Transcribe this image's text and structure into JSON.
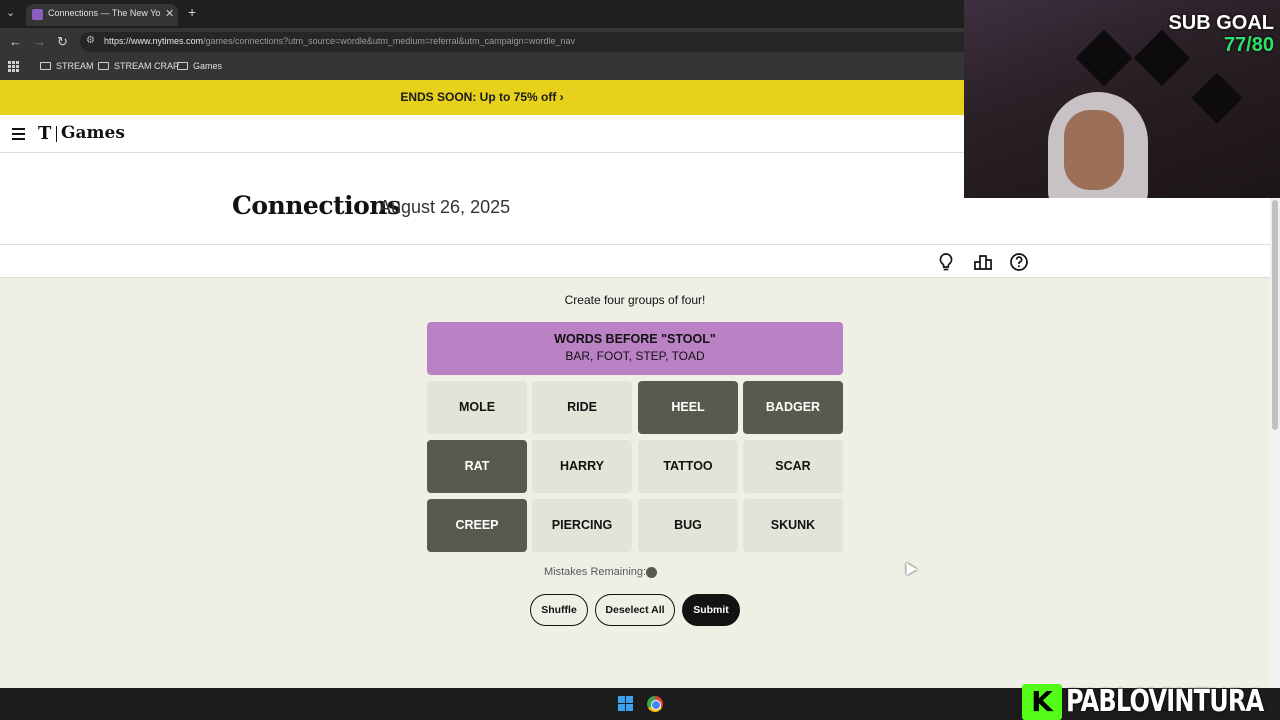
{
  "browser": {
    "tab_title": "Connections — The New York Ti",
    "url_host": "https://www.nytimes.com",
    "url_path": "/games/connections?utm_source=wordle&utm_medium=referral&utm_campaign=wordle_nav",
    "bookmarks": [
      "STREAM",
      "STREAM CRAP",
      "Games"
    ]
  },
  "banner": {
    "text": "ENDS SOON:  Up to 75% off ›"
  },
  "header": {
    "logo_t": "T",
    "logo_games": "Games"
  },
  "game": {
    "title": "Connections",
    "date": "August 26, 2025",
    "prompt": "Create four groups of four!",
    "solved_group": {
      "title": "WORDS BEFORE \"STOOL\"",
      "words": "BAR, FOOT, STEP, TOAD",
      "color": "#ba81c5"
    },
    "tiles": [
      {
        "word": "MOLE",
        "selected": false
      },
      {
        "word": "RIDE",
        "selected": false
      },
      {
        "word": "HEEL",
        "selected": true
      },
      {
        "word": "BADGER",
        "selected": true
      },
      {
        "word": "RAT",
        "selected": true
      },
      {
        "word": "HARRY",
        "selected": false
      },
      {
        "word": "TATTOO",
        "selected": false
      },
      {
        "word": "SCAR",
        "selected": false
      },
      {
        "word": "CREEP",
        "selected": true
      },
      {
        "word": "PIERCING",
        "selected": false
      },
      {
        "word": "BUG",
        "selected": false
      },
      {
        "word": "SKUNK",
        "selected": false
      }
    ],
    "mistakes_label": "Mistakes Remaining:",
    "mistakes_remaining": 1,
    "buttons": {
      "shuffle": "Shuffle",
      "deselect": "Deselect All",
      "submit": "Submit"
    }
  },
  "toolbar_icons": [
    "lightbulb-icon",
    "leaderboard-icon",
    "help-icon"
  ],
  "overlay": {
    "sub_goal_label": "SUB GOAL",
    "sub_goal_count": "77/80",
    "kick_logo": "K",
    "streamer_name": "PABLOVINTURA"
  },
  "colors": {
    "banner": "#e7d11c",
    "selected_tile": "#5a594e",
    "unselected_tile": "#e3e3d8",
    "board_bg": "#efefe6"
  }
}
